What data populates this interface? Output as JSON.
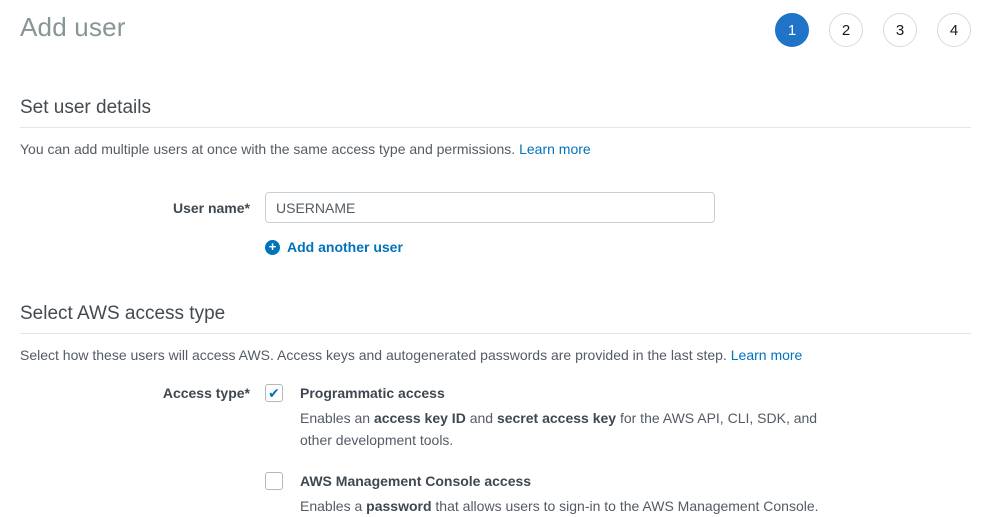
{
  "header": {
    "title": "Add user",
    "active_step": "1",
    "steps": [
      {
        "label": "1",
        "state": "active"
      },
      {
        "label": "2",
        "state": "inactive"
      },
      {
        "label": "3",
        "state": "inactive"
      },
      {
        "label": "4",
        "state": "inactive"
      }
    ]
  },
  "user_details": {
    "heading": "Set user details",
    "intro": "You can add multiple users at once with the same access type and permissions.",
    "learn_more_label": "Learn more",
    "username_label": "User name*",
    "username_value": "USERNAME",
    "plus_glyph": "+",
    "add_another_label": "Add another user"
  },
  "access_type": {
    "heading": "Select AWS access type",
    "intro": "Select how these users will access AWS. Access keys and autogenerated passwords are provided in the last step.",
    "learn_more_label": "Learn more",
    "label": "Access type*",
    "check_glyph": "✔",
    "options": [
      {
        "title": "Programmatic access",
        "checked": true,
        "desc": {
          "p1": "Enables an ",
          "b1": "access key ID",
          "p2": " and ",
          "b2": "secret access key",
          "p3": " for the AWS API, CLI, SDK, and other development tools."
        }
      },
      {
        "title": "AWS Management Console access",
        "checked": false,
        "desc": {
          "p1": "Enables a ",
          "b1": "password",
          "p2": " that allows users to sign-in to the AWS Management Console.",
          "b2": "",
          "p3": ""
        }
      }
    ]
  },
  "colors": {
    "link_blue": "#0073bb",
    "step_active_blue": "#2074c8",
    "title_gray": "#879596",
    "heading_text": "#444a50",
    "body_text": "#545b64",
    "divider": "#e3e6e8",
    "input_border": "#c9cfd1",
    "checkbox_border": "#b0b8ba"
  }
}
